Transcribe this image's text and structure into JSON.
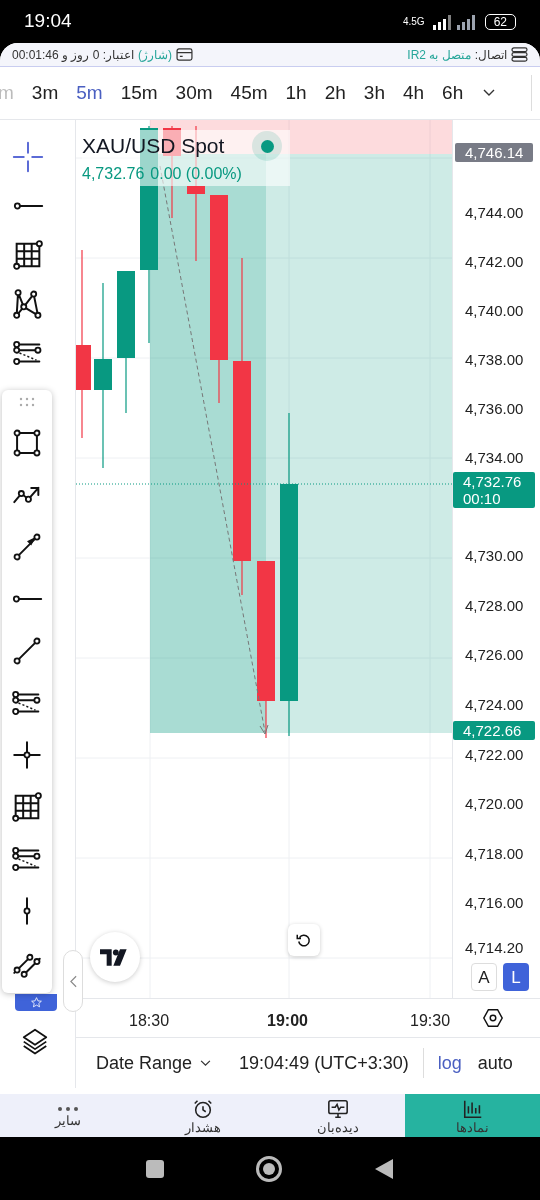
{
  "status_bar": {
    "time": "19:04",
    "network": "4.5G",
    "battery": "62"
  },
  "info_bar": {
    "connection_label": "اتصال:",
    "connection_value": "متصل به IR2",
    "credit_label": "اعتبار: 0 روز و 00:01:46",
    "credit_action": "(شارژ)"
  },
  "timeframes": [
    {
      "label": "m",
      "selected": false
    },
    {
      "label": "3m",
      "selected": false
    },
    {
      "label": "5m",
      "selected": true
    },
    {
      "label": "15m",
      "selected": false
    },
    {
      "label": "30m",
      "selected": false
    },
    {
      "label": "45m",
      "selected": false
    },
    {
      "label": "1h",
      "selected": false
    },
    {
      "label": "2h",
      "selected": false
    },
    {
      "label": "3h",
      "selected": false
    },
    {
      "label": "4h",
      "selected": false
    },
    {
      "label": "6h",
      "selected": false
    }
  ],
  "toolbar": [
    {
      "kind": "crosshair",
      "selected": true
    },
    {
      "kind": "ray",
      "selected": false
    },
    {
      "kind": "grid",
      "selected": false
    },
    {
      "kind": "pattern",
      "selected": false
    },
    {
      "kind": "fib",
      "selected": false
    }
  ],
  "drawing_panel": [
    {
      "kind": "rectangle"
    },
    {
      "kind": "path"
    },
    {
      "kind": "arrow"
    },
    {
      "kind": "ray"
    },
    {
      "kind": "trend"
    },
    {
      "kind": "fib"
    },
    {
      "kind": "cross"
    },
    {
      "kind": "grid"
    },
    {
      "kind": "fib"
    },
    {
      "kind": "vray"
    },
    {
      "kind": "parallel"
    }
  ],
  "chart": {
    "symbol": "XAU/USD Spot",
    "last_price": "4,732.76",
    "change": "0.00 (0.00%)"
  },
  "price_axis": {
    "ticks": [
      "4,744.00",
      "4,742.00",
      "4,740.00",
      "4,738.00",
      "4,736.00",
      "4,734.00",
      "4,730.00",
      "4,728.00",
      "4,726.00",
      "4,724.00",
      "4,722.00",
      "4,720.00",
      "4,718.00",
      "4,716.00",
      "4,714.20"
    ],
    "top_badge": "4,746.14",
    "last_badge": {
      "price": "4,732.76",
      "countdown": "00:10"
    },
    "bottom_badge": "4,722.66"
  },
  "scale_buttons": [
    {
      "label": "A",
      "selected": false
    },
    {
      "label": "L",
      "selected": true
    }
  ],
  "time_axis": [
    {
      "label": "18:30",
      "bold": false
    },
    {
      "label": "19:00",
      "bold": true
    },
    {
      "label": "19:30",
      "bold": false
    }
  ],
  "bottom_bar": {
    "date_range": "Date Range",
    "clock": "19:04:49 (UTC+3:30)"
  },
  "scale_modes": [
    {
      "label": "log",
      "selected": true
    },
    {
      "label": "auto",
      "selected": false
    }
  ],
  "nav": [
    {
      "kind": "chart",
      "label": "نمادها",
      "selected": true
    },
    {
      "kind": "monitor",
      "label": "دیده‌بان",
      "selected": false
    },
    {
      "kind": "alarm",
      "label": "هشدار",
      "selected": false
    },
    {
      "kind": "more",
      "label": "سایر",
      "selected": false
    }
  ]
}
